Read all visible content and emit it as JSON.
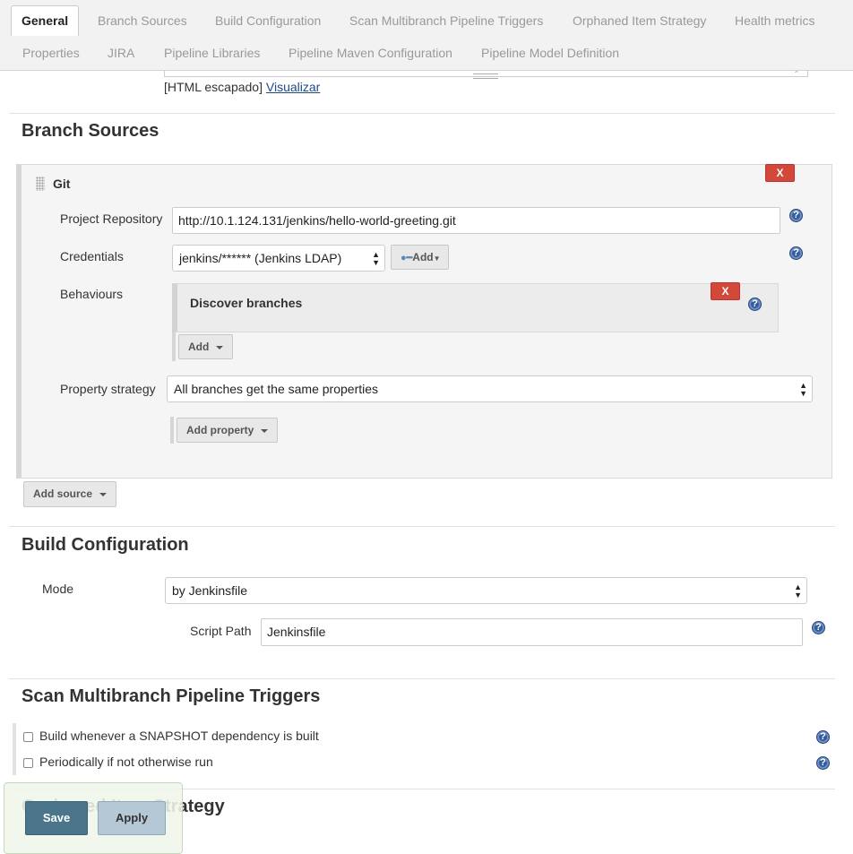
{
  "tabs": [
    {
      "label": "General",
      "active": true
    },
    {
      "label": "Branch Sources"
    },
    {
      "label": "Build Configuration"
    },
    {
      "label": "Scan Multibranch Pipeline Triggers"
    },
    {
      "label": "Orphaned Item Strategy"
    },
    {
      "label": "Health metrics"
    },
    {
      "label": "Properties"
    },
    {
      "label": "JIRA"
    },
    {
      "label": "Pipeline Libraries"
    },
    {
      "label": "Pipeline Maven Configuration"
    },
    {
      "label": "Pipeline Model Definition"
    }
  ],
  "description": {
    "escaped_label": "[HTML escapado]",
    "preview_link": "Visualizar"
  },
  "branch_sources": {
    "title": "Branch Sources",
    "git": {
      "title": "Git",
      "delete_label": "X",
      "project_repository_label": "Project Repository",
      "project_repository_value": "http://10.1.124.131/jenkins/hello-world-greeting.git",
      "credentials_label": "Credentials",
      "credentials_value": "jenkins/****** (Jenkins LDAP)",
      "add_credentials_label": "Add",
      "behaviours_label": "Behaviours",
      "behaviour_item": "Discover branches",
      "behaviour_delete_label": "X",
      "add_behaviour_label": "Add",
      "property_strategy_label": "Property strategy",
      "property_strategy_value": "All branches get the same properties",
      "add_property_label": "Add property"
    },
    "add_source_label": "Add source"
  },
  "build_configuration": {
    "title": "Build Configuration",
    "mode_label": "Mode",
    "mode_value": "by Jenkinsfile",
    "script_path_label": "Script Path",
    "script_path_value": "Jenkinsfile"
  },
  "scan_triggers": {
    "title": "Scan Multibranch Pipeline Triggers",
    "snapshot_label": "Build whenever a SNAPSHOT dependency is built",
    "snapshot_checked": false,
    "periodic_label": "Periodically if not otherwise run",
    "periodic_checked": false
  },
  "orphaned": {
    "title": "Orphaned Item Strategy"
  },
  "actions": {
    "save_label": "Save",
    "apply_label": "Apply"
  },
  "help_glyph": "?",
  "colors": {
    "save_button": "#4b758b",
    "apply_button": "#b4c8d6",
    "delete_button": "#d24939",
    "help_icon": "#345c9c",
    "link": "#204a87"
  }
}
